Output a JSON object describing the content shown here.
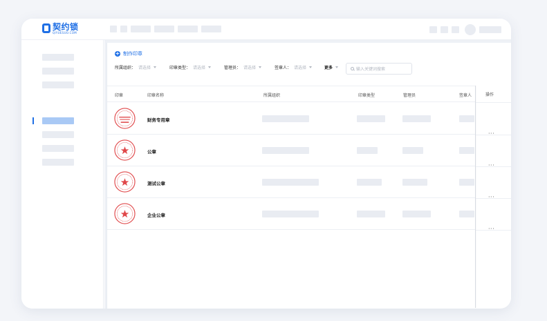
{
  "brand": {
    "name": "契约锁",
    "sub": "QIYUESUO.COM",
    "color": "#1f6fe5"
  },
  "toolbar": {
    "make_seal_label": "制作印章"
  },
  "filters": {
    "org": {
      "label": "所属组织：",
      "placeholder": "请选择"
    },
    "type": {
      "label": "印章类型：",
      "placeholder": "请选择"
    },
    "admin": {
      "label": "管理员：",
      "placeholder": "请选择"
    },
    "signer": {
      "label": "签章人：",
      "placeholder": "请选择"
    },
    "more_label": "更多",
    "search_placeholder": "输入关键词搜索"
  },
  "table": {
    "columns": [
      "印章",
      "印章名称",
      "所属组织",
      "印章类型",
      "管理员",
      "签章人",
      "操作"
    ],
    "rows": [
      {
        "name": "财务专用章",
        "seal_icon": "finance-seal-icon",
        "action": "···"
      },
      {
        "name": "公章",
        "seal_icon": "star-seal-icon",
        "action": "···"
      },
      {
        "name": "测试公章",
        "seal_icon": "star-seal-icon",
        "action": "···"
      },
      {
        "name": "企业公章",
        "seal_icon": "star-seal-icon",
        "action": "···"
      }
    ]
  },
  "colors": {
    "accent": "#1f6fe5",
    "seal_red": "#e0484a",
    "placeholder_block": "#e9ecf2",
    "active_nav": "#a9c9f5"
  }
}
